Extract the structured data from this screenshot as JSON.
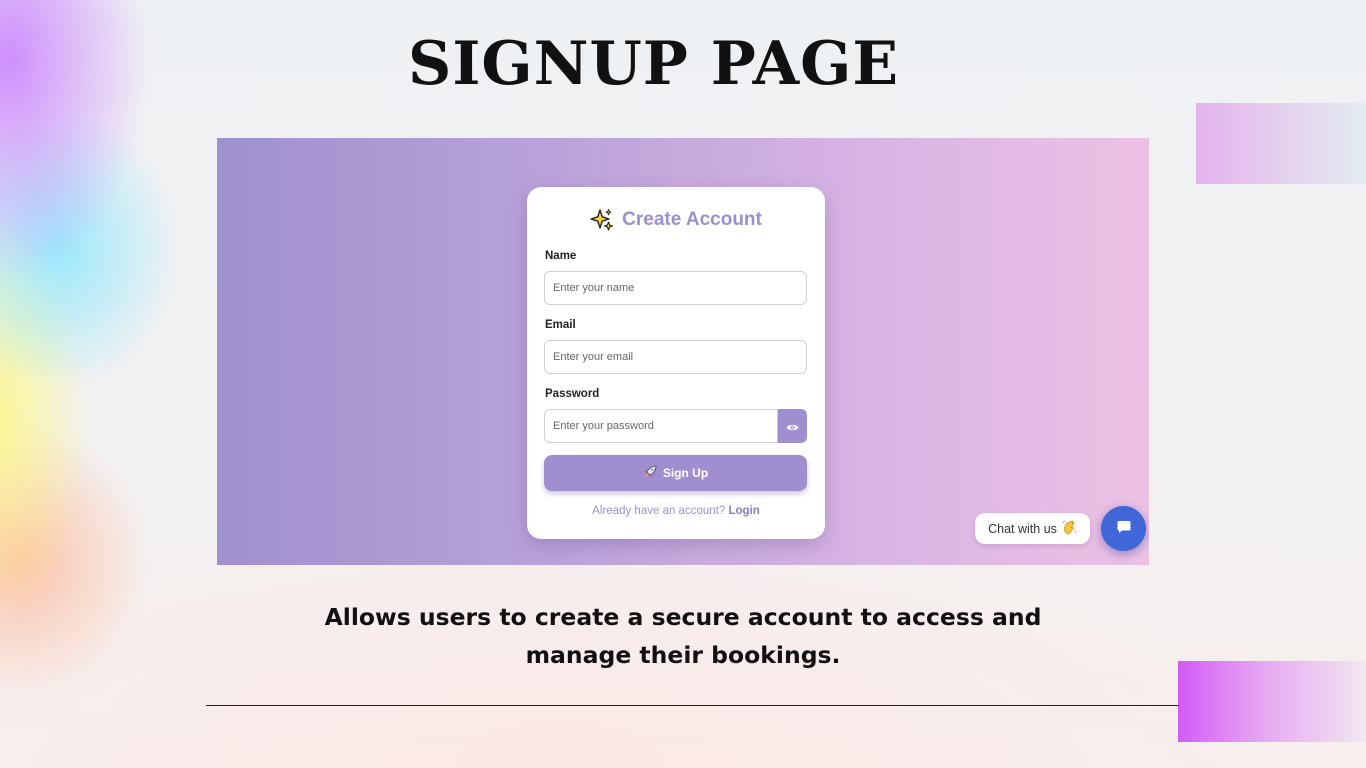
{
  "slide": {
    "title": "SIGNUP PAGE",
    "caption": "Allows users to create a secure account to access and manage their bookings."
  },
  "form": {
    "title": "Create Account",
    "title_icon": "sparkles-icon",
    "name_label": "Name",
    "name_placeholder": "Enter your name",
    "email_label": "Email",
    "email_placeholder": "Enter your email",
    "password_label": "Password",
    "password_placeholder": "Enter your password",
    "toggle_icon": "eye-icon",
    "submit_label": "Sign Up",
    "submit_icon": "rocket-icon",
    "login_prompt": "Already have an account?",
    "login_link": "Login"
  },
  "chat": {
    "label": "Chat with us",
    "label_icon": "waving-hand-icon",
    "button_icon": "chat-bubble-icon"
  },
  "colors": {
    "accent": "#a08fd0",
    "chat_button": "#3f67d8",
    "panel_gradient_start": "#9f90ce",
    "panel_gradient_end": "#edc1e4"
  }
}
